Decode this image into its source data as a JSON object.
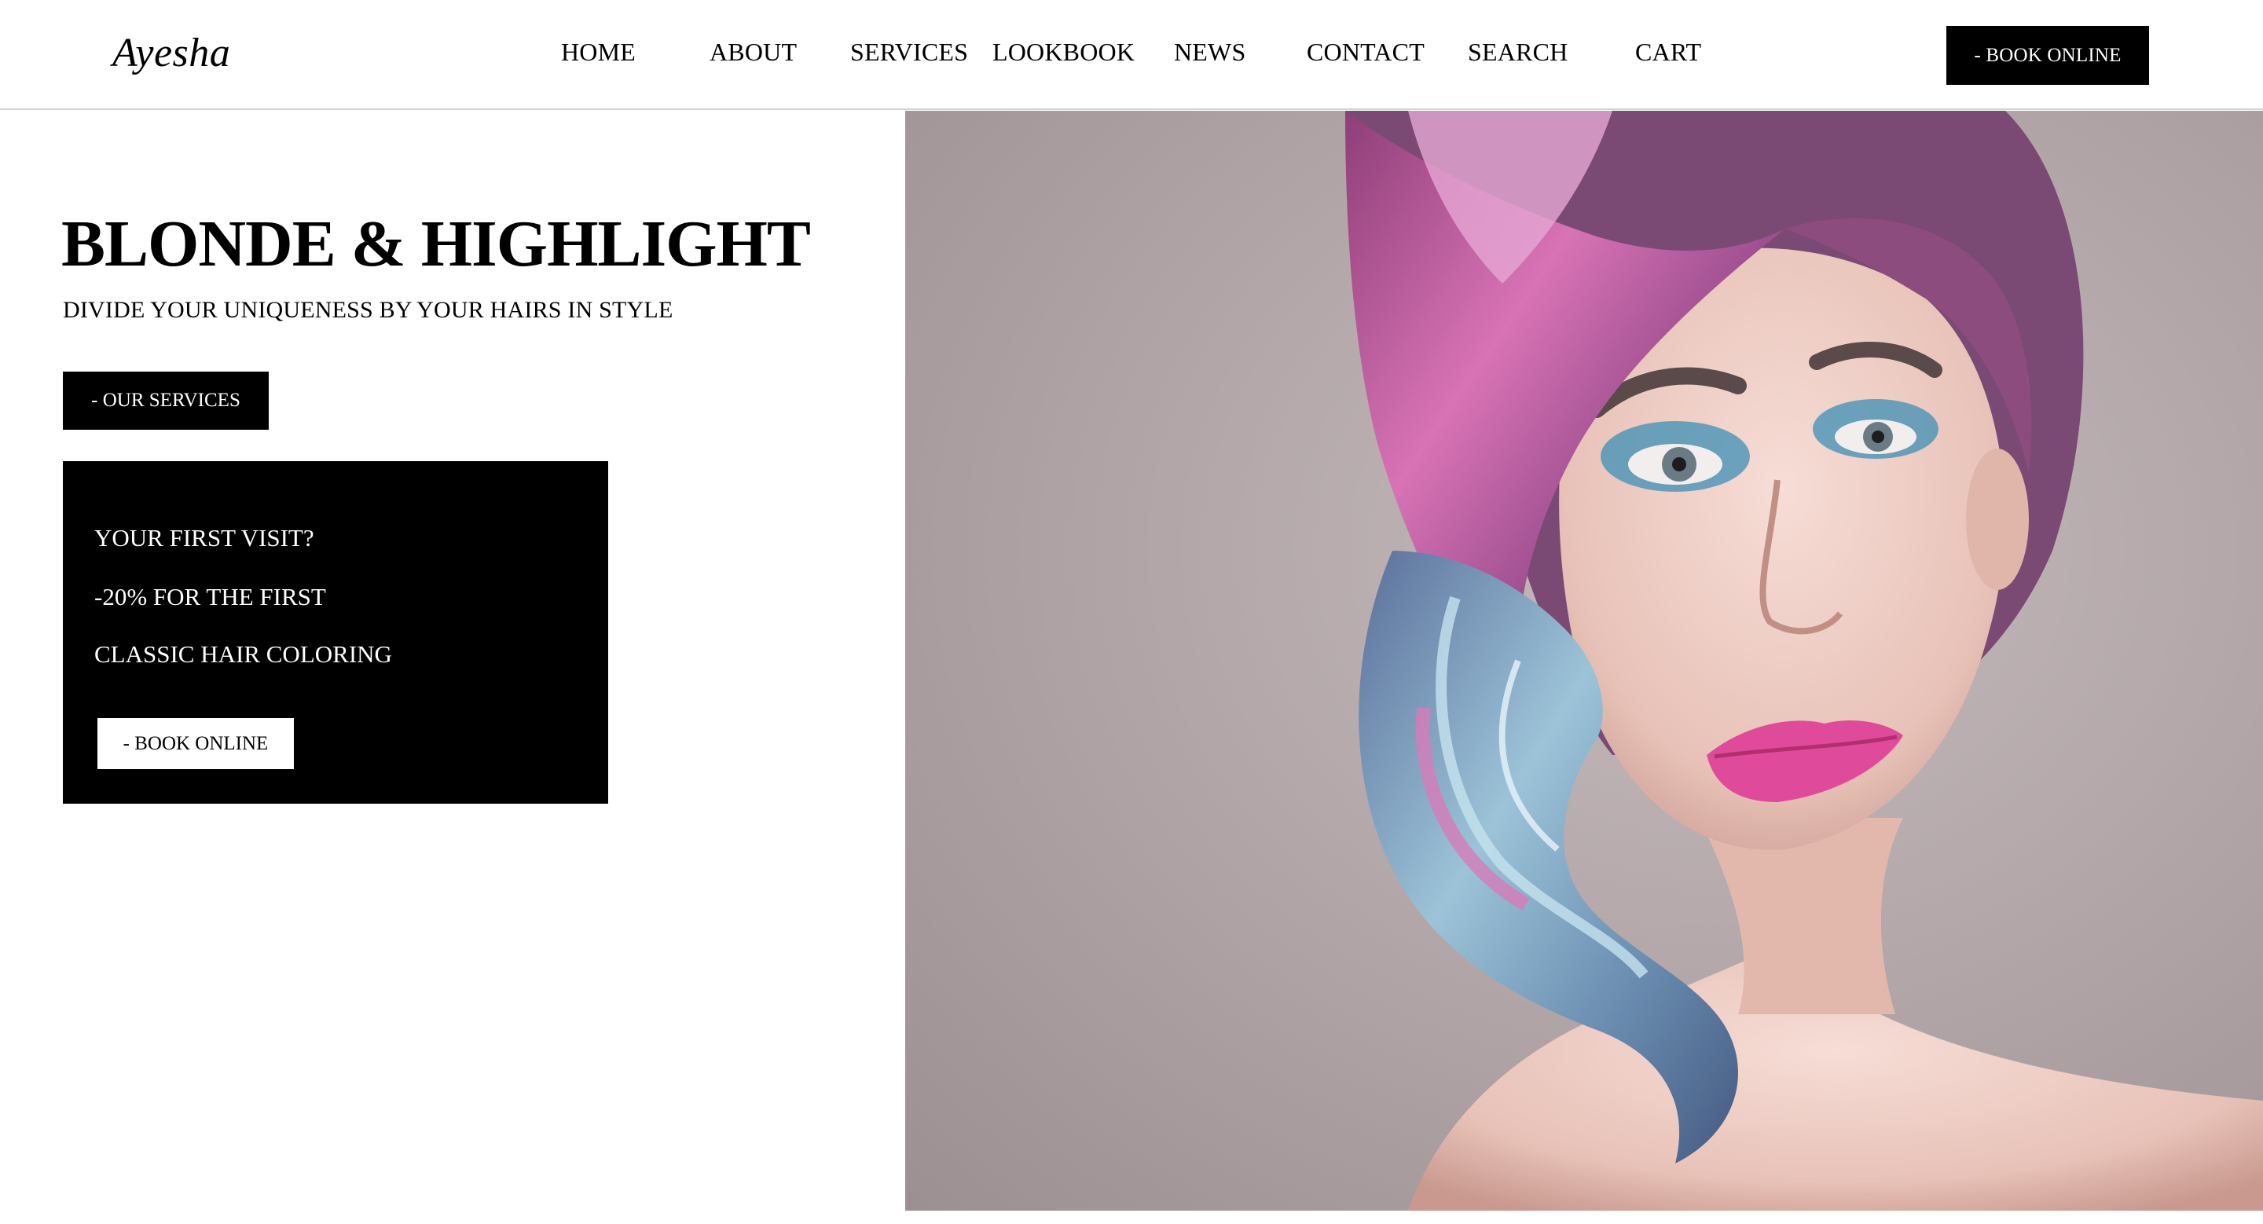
{
  "header": {
    "logo": "Ayesha",
    "nav": [
      "HOME",
      "ABOUT",
      "SERVICES",
      "LOOKBOOK",
      "NEWS",
      "CONTACT",
      "SEARCH",
      "CART"
    ],
    "book_online": "- BOOK ONLINE"
  },
  "hero": {
    "title": "BLONDE & HIGHLIGHT",
    "subtitle": "DIVIDE YOUR UNIQUENESS BY YOUR HAIRS IN STYLE",
    "services_button": "- OUR SERVICES"
  },
  "promo": {
    "line1": "YOUR FIRST VISIT?",
    "line2": "-20% FOR THE FIRST",
    "line3": "CLASSIC HAIR COLORING",
    "button": "- BOOK ONLINE"
  },
  "colors": {
    "background": "#ffffff",
    "accent": "#000000",
    "photo_backdrop": "#a79b9d",
    "hair_pink": "#c95a9b",
    "hair_blue": "#7ea9c5",
    "lips": "#e04a9a"
  }
}
